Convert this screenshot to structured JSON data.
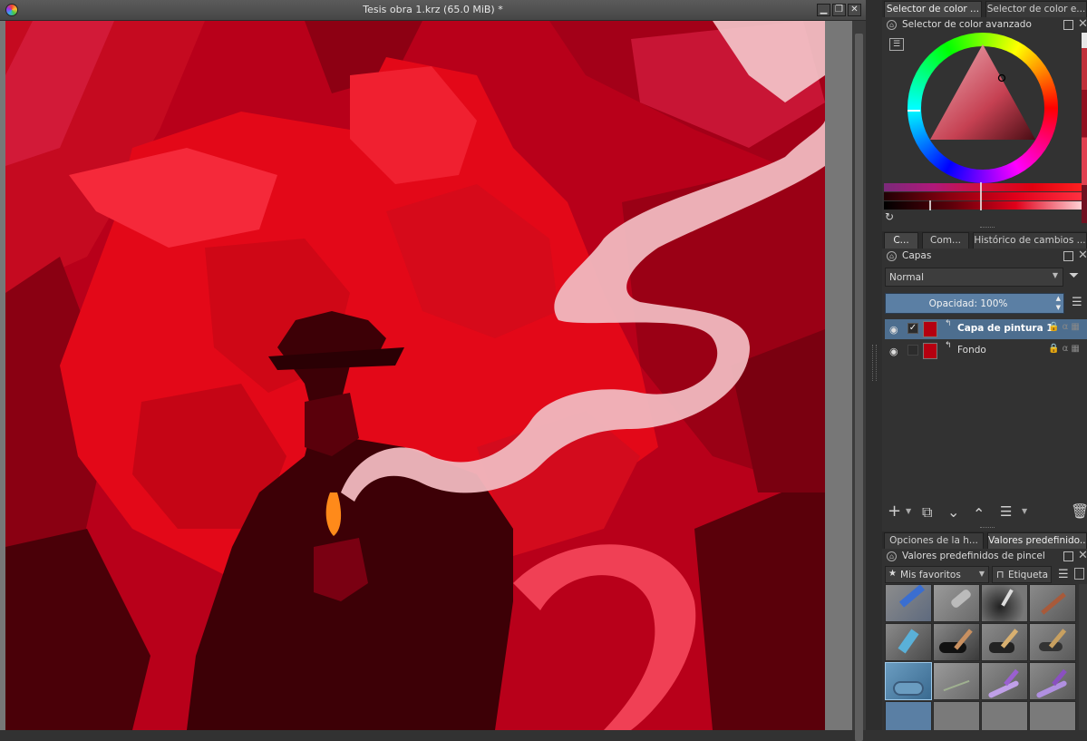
{
  "document": {
    "title": "Tesis obra 1.krz (65.0 MiB) *",
    "buttons": {
      "minimize": "▁",
      "restore": "❐",
      "close": "✕"
    }
  },
  "dockers": {
    "top_tabs": [
      "Selector de color ...",
      "Selector de color e..."
    ],
    "color_selector": {
      "title": "Selector de color avanzado",
      "accent_color": "#e0001a"
    },
    "mid_tabs": [
      "C...",
      "Com...",
      "Histórico de cambios ..."
    ],
    "layers": {
      "title": "Capas",
      "blend_mode": "Normal",
      "opacity_label": "Opacidad:  100%",
      "items": [
        {
          "name": "Capa de pintura 1",
          "visible": true,
          "active": true
        },
        {
          "name": "Fondo",
          "visible": true,
          "active": false
        }
      ],
      "toolbar_icons": [
        "add-layer-icon",
        "duplicate-layer-icon",
        "move-down-icon",
        "move-up-icon",
        "layer-properties-icon",
        "delete-layer-icon"
      ]
    },
    "bottom_tabs": [
      "Opciones de la h...",
      "Valores predefinido..."
    ],
    "brushes": {
      "title": "Valores predefinidos de pincel",
      "filter_value": "Mis favoritos",
      "tag_label": "Etiqueta"
    }
  }
}
